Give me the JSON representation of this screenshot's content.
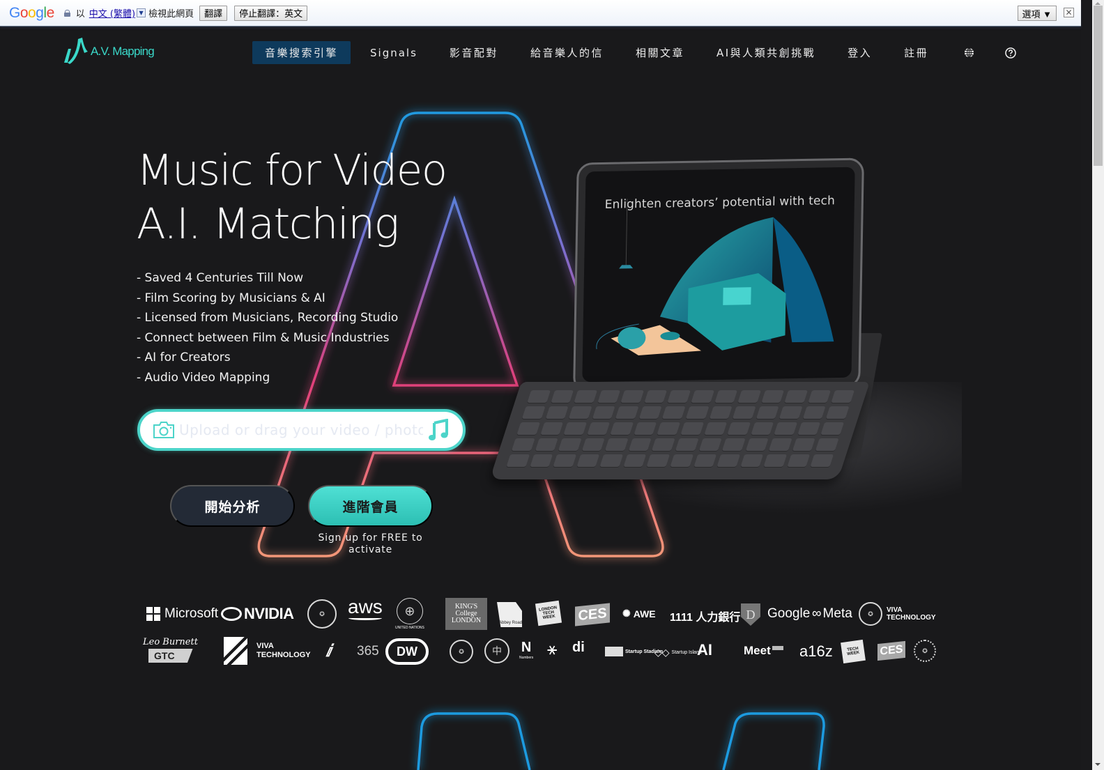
{
  "translate_bar": {
    "google_logo": [
      "G",
      "o",
      "o",
      "g",
      "l",
      "e"
    ],
    "prefix": "以",
    "language_link": "中文 (繁體)",
    "dropdown_glyph": "▼",
    "suffix": "檢視此網頁",
    "translate_button": "翻譯",
    "stop_button": "停止翻譯：英文",
    "options_button": "選項 ▼",
    "close_glyph": "✕"
  },
  "nav": {
    "logo_text": "A.V. Mapping",
    "items": [
      {
        "label": "音樂搜索引擎",
        "active": true
      },
      {
        "label": "Signals"
      },
      {
        "label": "影音配對"
      },
      {
        "label": "給音樂人的信"
      },
      {
        "label": "相關文章"
      },
      {
        "label": "AI與人類共創挑戰"
      },
      {
        "label": "登入"
      },
      {
        "label": "註冊"
      }
    ],
    "icons": [
      "globe-icon",
      "help-icon"
    ]
  },
  "hero": {
    "title_line1": "Music for Video",
    "title_line2": "A.I. Matching",
    "bullets": [
      "- Saved 4 Centuries Till Now",
      "- Film Scoring by Musicians & AI",
      "- Licensed from Musicians, Recording Studio",
      "- Connect between Film & Music Industries",
      "- AI for Creators",
      "- Audio Video Mapping"
    ],
    "upload_placeholder": "Upload or drag your video / photo",
    "analyze_button": "開始分析",
    "premium_button": "進階會員",
    "signup_note": "Sign up for FREE to activate",
    "tablet_caption": "Enlighten creators’ potential with tech"
  },
  "colors": {
    "accent": "#3ad8c9",
    "nav_active_bg": "#0e3a5c",
    "a_outline_top": "#1e9be0",
    "a_outline_mid": "#e0407a",
    "a_outline_bottom": "#f49a78"
  },
  "partner_logos": {
    "row1": [
      "Microsoft",
      "NVIDIA",
      "seal",
      "aws",
      "UNITED NATIONS",
      "KING'S College LONDON",
      "Abbey Road Studios",
      "LONDON TECH WEEK",
      "CES",
      "AWE",
      "1111 人力銀行",
      "D",
      "Google",
      "Meta",
      "seal",
      "VIVA TECHNOLOGY"
    ],
    "row2": [
      "Leo Burnett",
      "GTC",
      "university",
      "VIVA TECHNOLOGY",
      "IBC",
      "365",
      "DW",
      "seal",
      "中山",
      "Numbers",
      "symbol",
      "di",
      "Startup Stadium",
      "Startup Island",
      "AI",
      "Meet",
      "a16z",
      "TECH WEEK",
      "CES",
      "seal"
    ]
  }
}
